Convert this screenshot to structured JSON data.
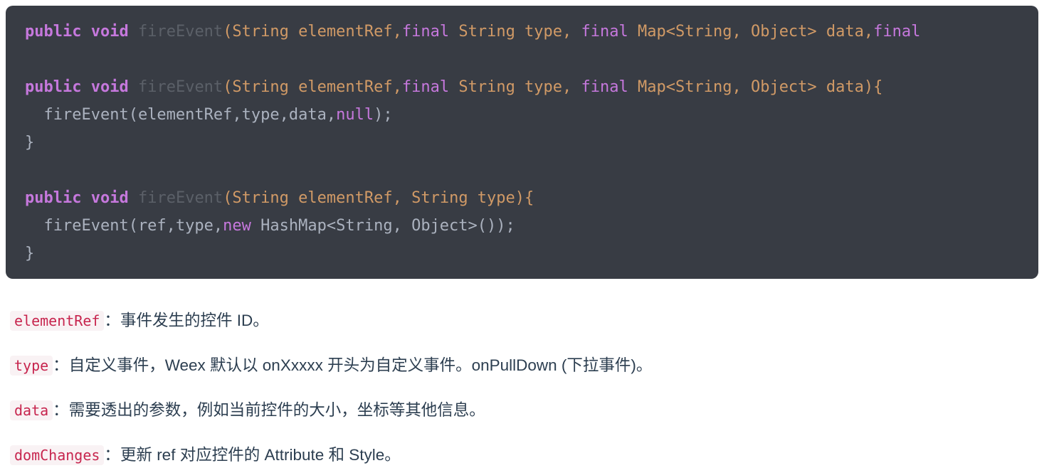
{
  "code_block": {
    "language": "java",
    "background_color": "#383c44",
    "lines": [
      {
        "id": "line-1",
        "tokens": [
          {
            "t": "public",
            "c": "kw"
          },
          {
            "t": " ",
            "c": "plain"
          },
          {
            "t": "void",
            "c": "kw"
          },
          {
            "t": " ",
            "c": "plain"
          },
          {
            "t": "fireEvent",
            "c": "fnname"
          },
          {
            "t": "(String elementRef,",
            "c": "type"
          },
          {
            "t": "final",
            "c": "kw2"
          },
          {
            "t": " String type, ",
            "c": "type"
          },
          {
            "t": "final",
            "c": "kw2"
          },
          {
            "t": " Map<String, Object> data,",
            "c": "type"
          },
          {
            "t": "final",
            "c": "kw2"
          }
        ]
      },
      {
        "id": "line-2",
        "tokens": []
      },
      {
        "id": "line-3",
        "tokens": [
          {
            "t": "public",
            "c": "kw"
          },
          {
            "t": " ",
            "c": "plain"
          },
          {
            "t": "void",
            "c": "kw"
          },
          {
            "t": " ",
            "c": "plain"
          },
          {
            "t": "fireEvent",
            "c": "fnname"
          },
          {
            "t": "(String elementRef,",
            "c": "type"
          },
          {
            "t": "final",
            "c": "kw2"
          },
          {
            "t": " String type, ",
            "c": "type"
          },
          {
            "t": "final",
            "c": "kw2"
          },
          {
            "t": " Map<String, Object> data){",
            "c": "type"
          }
        ]
      },
      {
        "id": "line-4",
        "tokens": [
          {
            "t": "  fireEvent(elementRef,type,data,",
            "c": "plain"
          },
          {
            "t": "null",
            "c": "lit"
          },
          {
            "t": ");",
            "c": "plain"
          }
        ]
      },
      {
        "id": "line-5",
        "tokens": [
          {
            "t": "}",
            "c": "plain"
          }
        ]
      },
      {
        "id": "line-6",
        "tokens": []
      },
      {
        "id": "line-7",
        "tokens": [
          {
            "t": "public",
            "c": "kw"
          },
          {
            "t": " ",
            "c": "plain"
          },
          {
            "t": "void",
            "c": "kw"
          },
          {
            "t": " ",
            "c": "plain"
          },
          {
            "t": "fireEvent",
            "c": "fnname"
          },
          {
            "t": "(String elementRef, String type){",
            "c": "type"
          }
        ]
      },
      {
        "id": "line-8",
        "tokens": [
          {
            "t": "  fireEvent(ref,type,",
            "c": "plain"
          },
          {
            "t": "new",
            "c": "lit"
          },
          {
            "t": " HashMap<String, Object>());",
            "c": "plain"
          }
        ]
      },
      {
        "id": "line-9",
        "tokens": [
          {
            "t": "}",
            "c": "plain"
          }
        ]
      }
    ]
  },
  "parameters": [
    {
      "name": "elementRef",
      "separator": "：",
      "description": "事件发生的控件 ID。"
    },
    {
      "name": "type",
      "separator": "：",
      "description": "自定义事件，Weex 默认以 onXxxxx 开头为自定义事件。onPullDown (下拉事件)。"
    },
    {
      "name": "data",
      "separator": "：",
      "description": "需要透出的参数，例如当前控件的大小，坐标等其他信息。"
    },
    {
      "name": "domChanges",
      "separator": "：",
      "description": "更新 ref 对应控件的 Attribute 和 Style。"
    }
  ],
  "colors": {
    "code_background": "#383c44",
    "keyword": "#c678dd",
    "function_name": "#5b6068",
    "type_token": "#d19a66",
    "plain_token": "#abb2bf",
    "inline_code_text": "#c7254e",
    "inline_code_background": "#f9f2f4",
    "prose_text": "#2c3e50",
    "page_background": "#ffffff"
  }
}
